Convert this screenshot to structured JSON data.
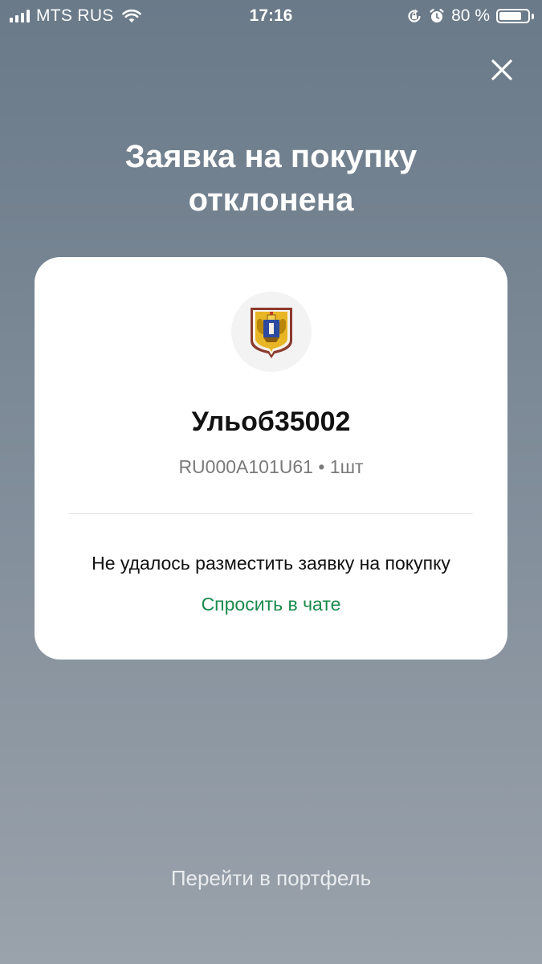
{
  "status_bar": {
    "carrier": "MTS RUS",
    "time": "17:16",
    "battery_label": "80 %",
    "battery_level": 0.8,
    "icons": [
      "signal-icon",
      "wifi-icon",
      "rotation-lock-icon",
      "alarm-icon",
      "battery-icon"
    ]
  },
  "header": {
    "close_icon": "close-icon",
    "title": "Заявка на покупку отклонена"
  },
  "card": {
    "emblem_icon": "coat-of-arms-icon",
    "bond_name": "Ульоб35002",
    "bond_meta": "RU000A101U61 • 1шт",
    "error_message": "Не удалось разместить заявку на покупку",
    "chat_link": "Спросить в чате"
  },
  "footer": {
    "portfolio_link": "Перейти в портфель"
  },
  "colors": {
    "accent_green": "#1a8a4c",
    "card_bg": "#ffffff"
  }
}
